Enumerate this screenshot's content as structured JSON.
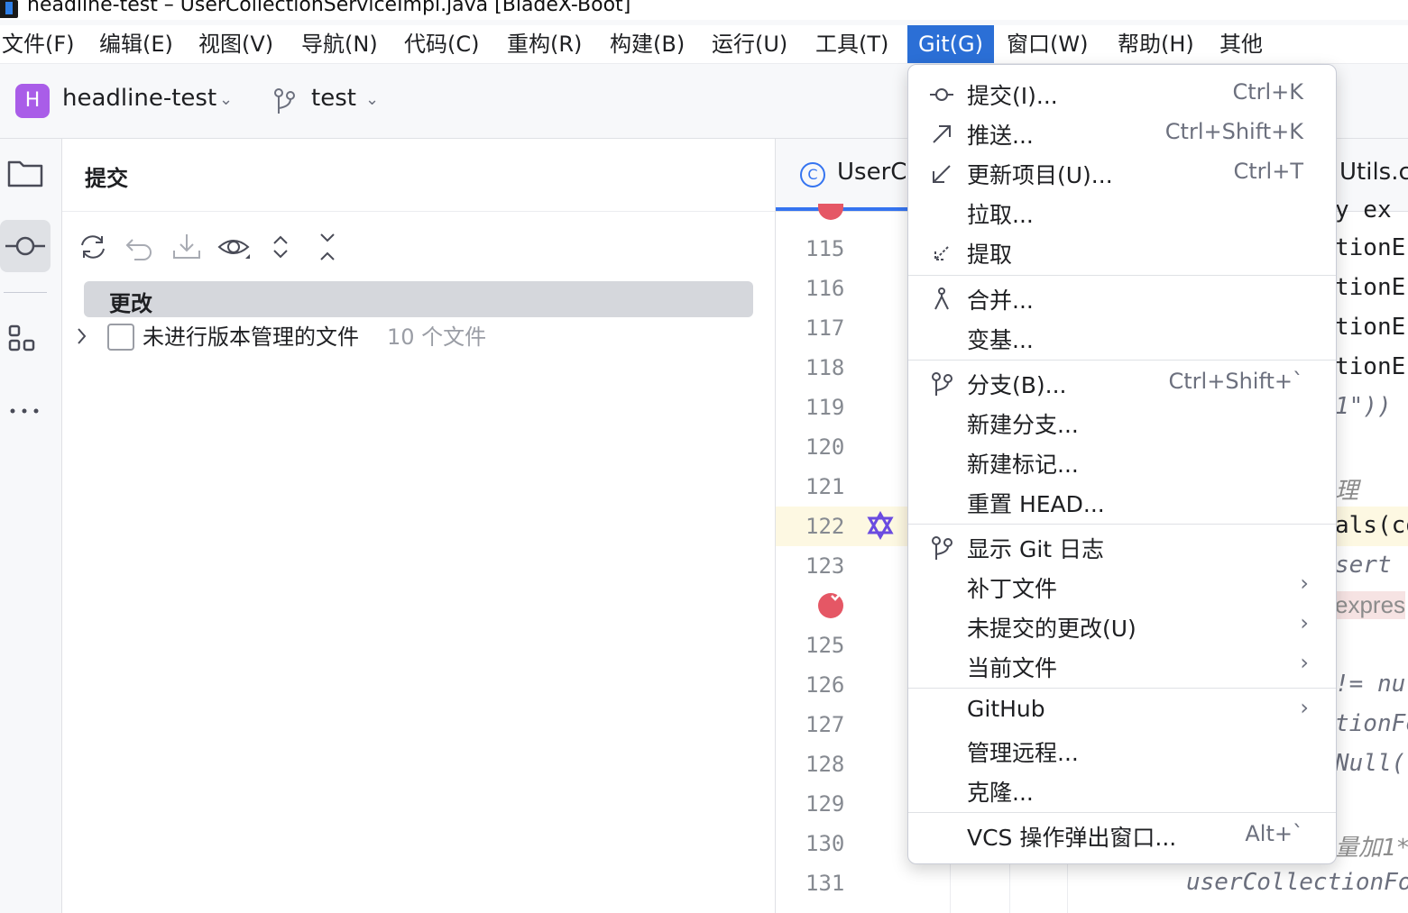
{
  "window": {
    "title": "headline-test – UserCollectionServiceImpl.java [BladeX-Boot]"
  },
  "menubar": {
    "items": [
      {
        "label": "文件(F)"
      },
      {
        "label": "编辑(E)"
      },
      {
        "label": "视图(V)"
      },
      {
        "label": "导航(N)"
      },
      {
        "label": "代码(C)"
      },
      {
        "label": "重构(R)"
      },
      {
        "label": "构建(B)"
      },
      {
        "label": "运行(U)"
      },
      {
        "label": "工具(T)"
      },
      {
        "label": "Git(G)"
      },
      {
        "label": "窗口(W)"
      },
      {
        "label": "帮助(H)"
      },
      {
        "label": "其他"
      }
    ],
    "active": "Git(G)"
  },
  "toolbar": {
    "project_badge": "H",
    "project_name": "headline-test",
    "branch_name": "test"
  },
  "commit_panel": {
    "title": "提交",
    "changes_label": "更改",
    "unversioned_label": "未进行版本管理的文件",
    "unversioned_count": "10 个文件"
  },
  "editor": {
    "active_tab": "UserC",
    "right_tab": "Utils.c",
    "line_numbers": [
      "115",
      "116",
      "117",
      "118",
      "119",
      "120",
      "121",
      "122",
      "123",
      "125",
      "126",
      "127",
      "128",
      "129",
      "130",
      "131"
    ],
    "code_fragments": [
      "y ex",
      "tionEr",
      "tionEr",
      "tionEr",
      "tionEr",
      "1\"))",
      "理",
      "als(co",
      "sert",
      "expres",
      "!= nu",
      "tionFo",
      "Null(",
      "量加1*",
      "userCollectionFo"
    ]
  },
  "git_menu": {
    "items": [
      {
        "label": "提交(I)...",
        "shortcut": "Ctrl+K",
        "icon": "commit-icon"
      },
      {
        "label": "推送...",
        "shortcut": "Ctrl+Shift+K",
        "icon": "push-arrow-icon"
      },
      {
        "label": "更新项目(U)...",
        "shortcut": "Ctrl+T",
        "icon": "update-arrow-icon"
      },
      {
        "label": "拉取...",
        "shortcut": "",
        "icon": ""
      },
      {
        "label": "提取",
        "shortcut": "",
        "icon": "fetch-icon"
      },
      {
        "label": "合并...",
        "shortcut": "",
        "icon": "merge-icon"
      },
      {
        "label": "变基...",
        "shortcut": "",
        "icon": ""
      },
      {
        "label": "分支(B)...",
        "shortcut": "Ctrl+Shift+`",
        "icon": "branch-icon"
      },
      {
        "label": "新建分支...",
        "shortcut": "",
        "icon": ""
      },
      {
        "label": "新建标记...",
        "shortcut": "",
        "icon": ""
      },
      {
        "label": "重置 HEAD...",
        "shortcut": "",
        "icon": ""
      },
      {
        "label": "显示 Git 日志",
        "shortcut": "",
        "icon": "git-log-icon"
      },
      {
        "label": "补丁文件",
        "shortcut": "",
        "icon": "",
        "submenu": true
      },
      {
        "label": "未提交的更改(U)",
        "shortcut": "",
        "icon": "",
        "submenu": true
      },
      {
        "label": "当前文件",
        "shortcut": "",
        "icon": "",
        "submenu": true
      },
      {
        "label": "GitHub",
        "shortcut": "",
        "icon": "",
        "submenu": true
      },
      {
        "label": "管理远程...",
        "shortcut": "",
        "icon": ""
      },
      {
        "label": "克隆...",
        "shortcut": "",
        "icon": ""
      },
      {
        "label": "VCS 操作弹出窗口...",
        "shortcut": "Alt+`",
        "icon": ""
      }
    ]
  }
}
